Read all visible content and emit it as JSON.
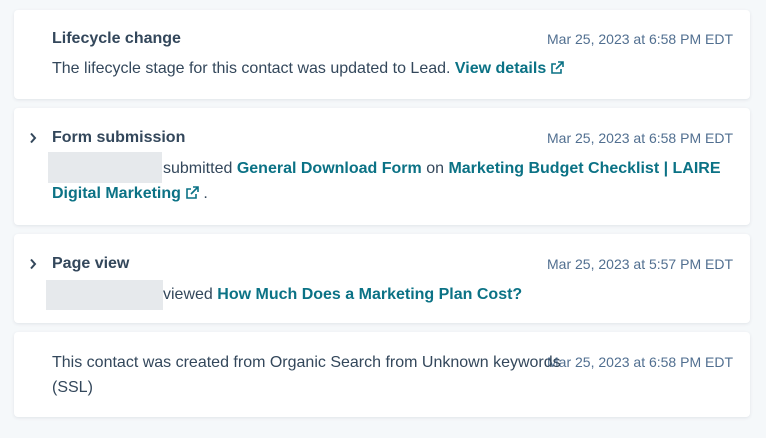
{
  "colors": {
    "link": "#0b7285",
    "text": "#33475b",
    "muted": "#516f90",
    "background": "#f5f8fa",
    "redaction": "#e6e9ec"
  },
  "events": {
    "lifecycle": {
      "title": "Lifecycle change",
      "timestamp": "Mar 25, 2023 at 6:58 PM EDT",
      "text": "The lifecycle stage for this contact was updated to Lead.",
      "link_label": "View details",
      "icon": "external-link-icon"
    },
    "form": {
      "title": "Form submission",
      "timestamp": "Mar 25, 2023 at 6:58 PM EDT",
      "verb": "submitted",
      "form_name": "General Download Form",
      "preposition": "on",
      "page_line1": "Marketing Budget Checklist | LAIRE",
      "page_line2": "Digital Marketing",
      "period": ".",
      "icon": "chevron-right-icon"
    },
    "pageview": {
      "title": "Page view",
      "timestamp": "Mar 25, 2023 at 5:57 PM EDT",
      "verb": "viewed",
      "page_name": "How Much Does a Marketing Plan Cost?",
      "icon": "chevron-right-icon"
    },
    "created": {
      "timestamp": "Mar 25, 2023 at 6:58 PM EDT",
      "line1": "This contact was created from Organic Search from Unknown keywords",
      "line2": "(SSL)"
    }
  }
}
